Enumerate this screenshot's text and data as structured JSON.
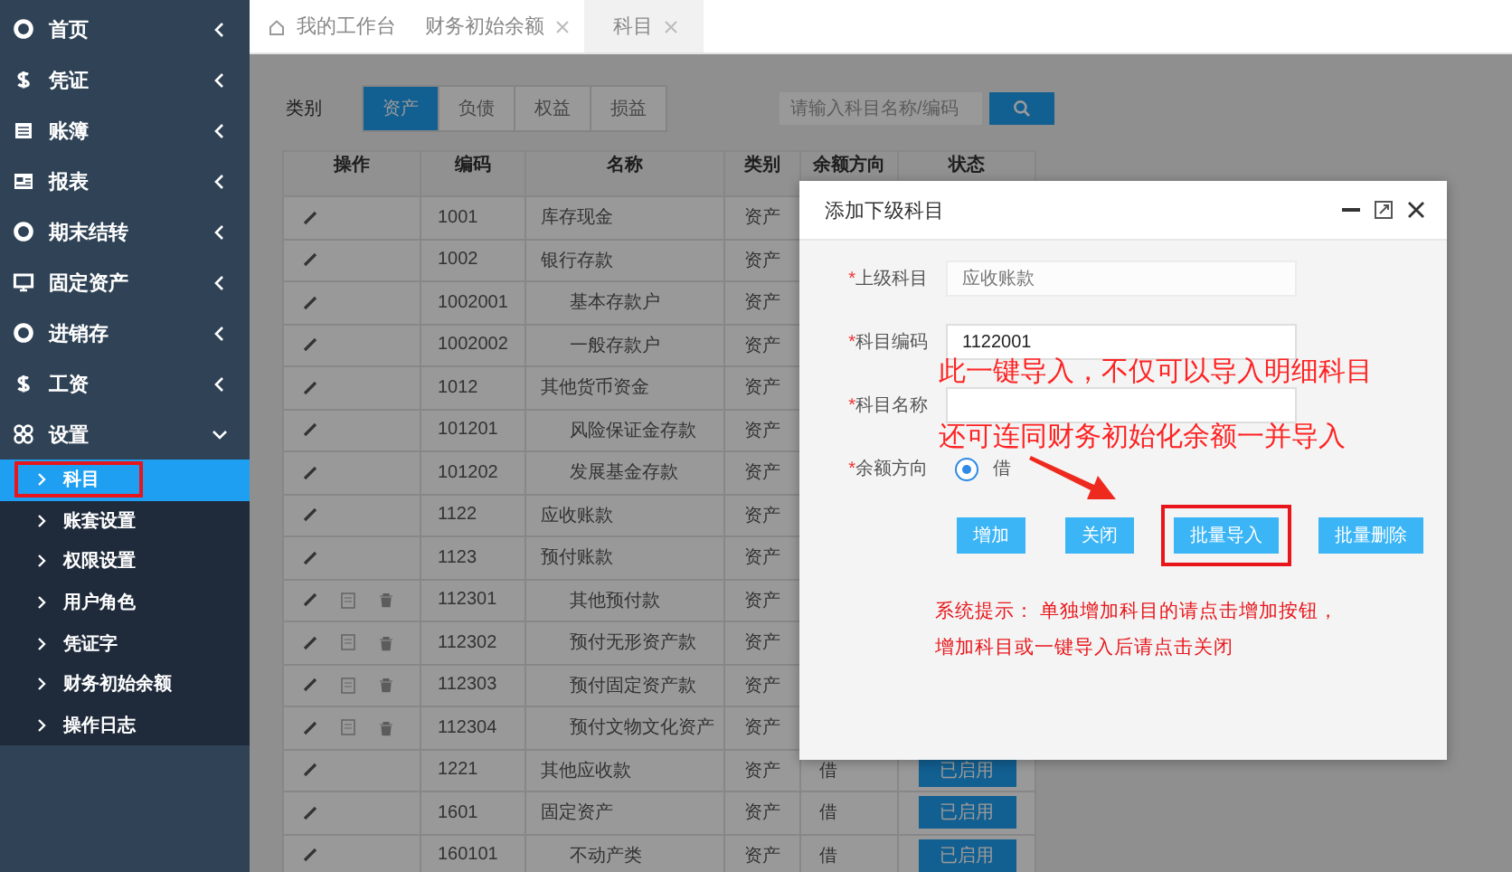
{
  "sidebar": {
    "items": [
      {
        "label": "首页",
        "expanded": false
      },
      {
        "label": "凭证",
        "expanded": false
      },
      {
        "label": "账簿",
        "expanded": false
      },
      {
        "label": "报表",
        "expanded": false
      },
      {
        "label": "期末结转",
        "expanded": false
      },
      {
        "label": "固定资产",
        "expanded": false
      },
      {
        "label": "进销存",
        "expanded": false
      },
      {
        "label": "工资",
        "expanded": false
      },
      {
        "label": "设置",
        "expanded": true,
        "children": [
          {
            "label": "科目",
            "selected": true,
            "annotated": true
          },
          {
            "label": "账套设置",
            "selected": false,
            "annotated": false
          },
          {
            "label": "权限设置",
            "selected": false,
            "annotated": false
          },
          {
            "label": "用户角色",
            "selected": false,
            "annotated": false
          },
          {
            "label": "凭证字",
            "selected": false,
            "annotated": false
          },
          {
            "label": "财务初始余额",
            "selected": false,
            "annotated": false
          },
          {
            "label": "操作日志",
            "selected": false,
            "annotated": false
          }
        ]
      }
    ]
  },
  "tabs": [
    {
      "label": "我的工作台",
      "selected": false,
      "closable": false
    },
    {
      "label": "财务初始余额",
      "selected": false,
      "closable": true
    },
    {
      "label": "科目",
      "selected": true,
      "closable": true
    }
  ],
  "filter": {
    "label": "类别",
    "categories": [
      {
        "label": "资产",
        "selected": true
      },
      {
        "label": "负债",
        "selected": false
      },
      {
        "label": "权益",
        "selected": false
      },
      {
        "label": "损益",
        "selected": false
      }
    ],
    "search": {
      "placeholder": "请输入科目名称/编码"
    }
  },
  "table": {
    "columns": [
      "操作",
      "编码",
      "名称",
      "类别",
      "余额方向",
      "状态"
    ],
    "rows": [
      {
        "code": "1001",
        "name": "库存现金",
        "category": "资产",
        "full_actions": false
      },
      {
        "code": "1002",
        "name": "银行存款",
        "category": "资产",
        "full_actions": false,
        "children": [
          {
            "code": "1002001",
            "name": "基本存款户",
            "category": "资产",
            "full_actions": false
          },
          {
            "code": "1002002",
            "name": "一般存款户",
            "category": "资产",
            "full_actions": false
          }
        ]
      },
      {
        "code": "1012",
        "name": "其他货币资金",
        "category": "资产",
        "full_actions": false,
        "children": [
          {
            "code": "101201",
            "name": "风险保证金存款",
            "category": "资产",
            "full_actions": false
          },
          {
            "code": "101202",
            "name": "发展基金存款",
            "category": "资产",
            "full_actions": false
          }
        ]
      },
      {
        "code": "1122",
        "name": "应收账款",
        "category": "资产",
        "full_actions": false
      },
      {
        "code": "1123",
        "name": "预付账款",
        "category": "资产",
        "full_actions": false,
        "children": [
          {
            "code": "112301",
            "name": "其他预付款",
            "category": "资产",
            "full_actions": true
          },
          {
            "code": "112302",
            "name": "预付无形资产款",
            "category": "资产",
            "full_actions": true
          },
          {
            "code": "112303",
            "name": "预付固定资产款",
            "category": "资产",
            "full_actions": true
          },
          {
            "code": "112304",
            "name": "预付文物文化资产",
            "category": "资产",
            "full_actions": true
          }
        ]
      },
      {
        "code": "1221",
        "name": "其他应收款",
        "category": "资产",
        "direction": "借",
        "status": "已启用",
        "full_actions": false
      },
      {
        "code": "1601",
        "name": "固定资产",
        "category": "资产",
        "direction": "借",
        "status": "已启用",
        "full_actions": false,
        "children": [
          {
            "code": "160101",
            "name": "不动产类",
            "category": "资产",
            "direction": "借",
            "status": "已启用",
            "full_actions": false
          }
        ]
      }
    ]
  },
  "dialog": {
    "title": "添加下级科目",
    "fields": [
      {
        "kind": "text",
        "mark": "*",
        "label": "上级科目",
        "value": "应收账款",
        "readonly": true
      },
      {
        "kind": "text",
        "mark": "*",
        "label": "科目编码",
        "value": "1122001",
        "readonly": false
      },
      {
        "kind": "text",
        "mark": "*",
        "label": "科目名称",
        "readonly": false
      },
      {
        "kind": "radio",
        "mark": "*",
        "label": "余额方向",
        "options": [
          {
            "label": "借",
            "selected": true
          }
        ]
      }
    ],
    "buttons": [
      {
        "label": "增加",
        "annotated": false
      },
      {
        "label": "关闭",
        "annotated": false
      },
      {
        "label": "批量导入",
        "annotated": true
      },
      {
        "label": "批量删除",
        "annotated": false
      }
    ],
    "hint": {
      "lines": [
        "系统提示： 单独增加科目的请点击增加按钮，",
        "增加科目或一键导入后请点击关闭"
      ]
    }
  },
  "callout": {
    "lines": [
      "此一键导入，不仅可以导入明细科目",
      "还可连同财务初始化余额一并导入"
    ]
  }
}
